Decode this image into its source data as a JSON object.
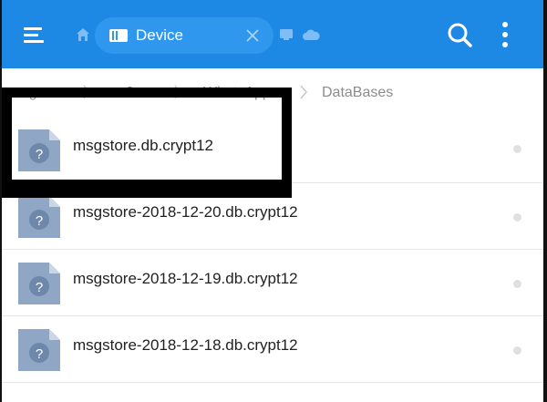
{
  "appbar": {
    "tab_label": "Device",
    "icons": [
      "menu-icon",
      "home-icon",
      "device-icon",
      "close-icon",
      "tablet-icon",
      "cloud-icon",
      "search-icon",
      "more-vertical-icon"
    ],
    "color": "#1e88e5"
  },
  "breadcrumb": {
    "items": [
      "storage",
      "0",
      "WhatsApp",
      "DataBases"
    ]
  },
  "files": [
    {
      "name": "msgstore.db.crypt12",
      "icon": "unknown-file-icon"
    },
    {
      "name": "msgstore-2018-12-20.db.crypt12",
      "icon": "unknown-file-icon"
    },
    {
      "name": "msgstore-2018-12-19.db.crypt12",
      "icon": "unknown-file-icon"
    },
    {
      "name": "msgstore-2018-12-18.db.crypt12",
      "icon": "unknown-file-icon"
    }
  ],
  "colors": {
    "accent": "#1e88e5",
    "file_icon": "#8fa6c4",
    "highlight": "#000000"
  }
}
